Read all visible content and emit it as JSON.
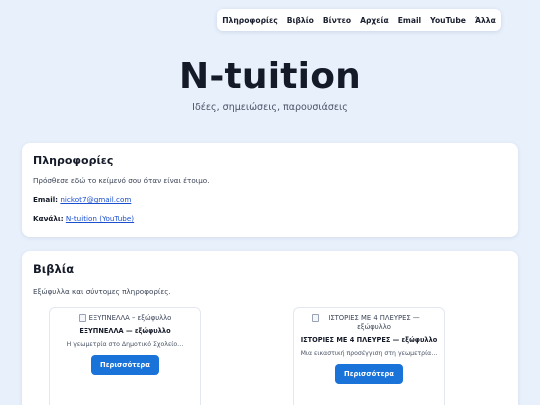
{
  "nav": {
    "items": [
      "Πληροφορίες",
      "Βιβλίο",
      "Βίντεο",
      "Αρχεία",
      "Email",
      "YouTube",
      "Άλλα"
    ]
  },
  "hero": {
    "title": "N-tuition",
    "subtitle": "Ιδέες, σημειώσεις, παρουσιάσεις"
  },
  "info": {
    "heading": "Πληροφορίες",
    "text": "Πρόσθεσε εδώ το κείμενό σου όταν είναι έτοιμο.",
    "email_label": "Email:",
    "email_value": "nickot7@gmail.com",
    "channel_label": "Κανάλι:",
    "channel_value": "N-tuition (YouTube)"
  },
  "books": {
    "heading": "Βιβλία",
    "intro": "Εξώφυλλα και σύντομες πληροφορίες.",
    "items": [
      {
        "image_alt": "ΕΞΥΠΝΕΛΛΑ – εξώφυλλο",
        "title": "ΕΞΥΠΝΕΛΛΑ — εξώφυλλο",
        "desc": "Η γεωμετρία στο Δημοτικό Σχολείο…",
        "button": "Περισσότερα"
      },
      {
        "image_alt": "ΙΣΤΟΡΙΕΣ ΜΕ 4 ΠΛΕΥΡΕΣ — εξώφυλλο",
        "title": "ΙΣΤΟΡΙΕΣ ΜΕ 4 ΠΛΕΥΡΕΣ — εξώφυλλο",
        "desc": "Μια εικαστική προσέγγιση στη γεωμετρία…",
        "button": "Περισσότερα"
      }
    ]
  }
}
